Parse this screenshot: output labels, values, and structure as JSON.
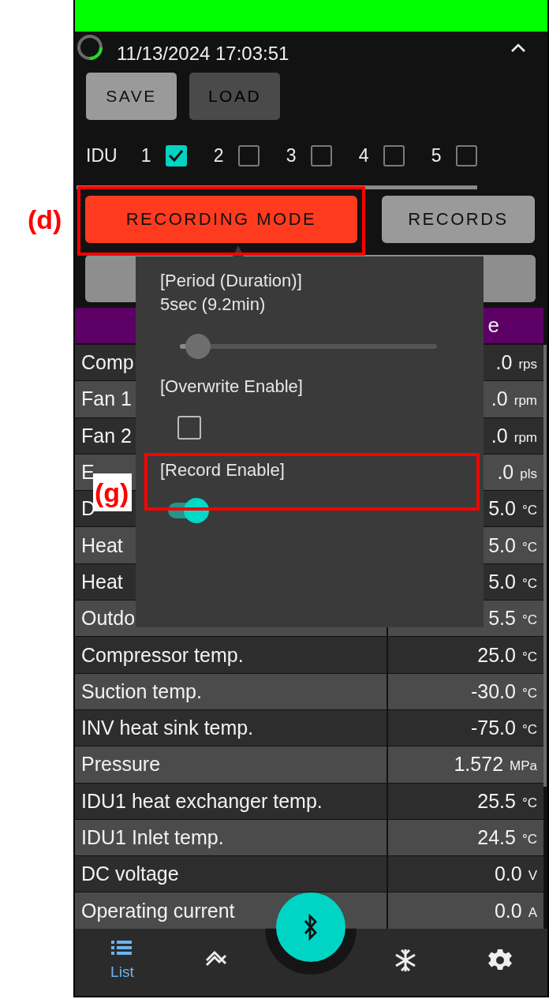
{
  "header": {
    "timestamp": "11/13/2024 17:03:51"
  },
  "file_buttons": [
    {
      "label": "SAVE",
      "disabled": false
    },
    {
      "label": "LOAD",
      "disabled": true
    }
  ],
  "idu": {
    "label": "IDU",
    "units": [
      {
        "number": "1",
        "checked": true
      },
      {
        "number": "2",
        "checked": false
      },
      {
        "number": "3",
        "checked": false
      },
      {
        "number": "4",
        "checked": false
      },
      {
        "number": "5",
        "checked": false
      }
    ]
  },
  "mode_buttons": [
    {
      "label": "RECORDING MODE",
      "selected": true
    },
    {
      "label": "RECORDS",
      "selected": false
    }
  ],
  "table": {
    "header": "e",
    "rows": [
      {
        "label": "Comp",
        "value": ".0",
        "unit": "rps"
      },
      {
        "label": "Fan 1",
        "value": ".0",
        "unit": "rpm"
      },
      {
        "label": "Fan 2",
        "value": ".0",
        "unit": "rpm"
      },
      {
        "label": "E",
        "value": ".0",
        "unit": "pls"
      },
      {
        "label": "D",
        "value": "5.0",
        "unit": "°C"
      },
      {
        "label": "Heat",
        "value": "5.0",
        "unit": "°C"
      },
      {
        "label": "Heat",
        "value": "5.0",
        "unit": "°C"
      },
      {
        "label": "Outdo",
        "value": "5.5",
        "unit": "°C"
      },
      {
        "label": "Compressor temp.",
        "value": "25.0",
        "unit": "°C"
      },
      {
        "label": "Suction temp.",
        "value": "-30.0",
        "unit": "°C"
      },
      {
        "label": "INV heat sink temp.",
        "value": "-75.0",
        "unit": "°C"
      },
      {
        "label": "Pressure",
        "value": "1.572",
        "unit": "MPa"
      },
      {
        "label": "IDU1 heat exchanger temp.",
        "value": "25.5",
        "unit": "°C"
      },
      {
        "label": "IDU1 Inlet temp.",
        "value": "24.5",
        "unit": "°C"
      },
      {
        "label": "DC voltage",
        "value": "0.0",
        "unit": "V"
      },
      {
        "label": "Operating current",
        "value": "0.0",
        "unit": "A"
      }
    ]
  },
  "popover": {
    "items": [
      {
        "kind": "slider",
        "label": "[Period (Duration)]",
        "value": "5sec (9.2min)",
        "level": 0.07
      },
      {
        "kind": "checkbox",
        "label": "[Overwrite Enable]",
        "checked": false
      },
      {
        "kind": "toggle",
        "label": "[Record Enable]",
        "on": true
      }
    ]
  },
  "callouts": [
    {
      "label": "(d)"
    },
    {
      "label": "(g)"
    }
  ],
  "bottom_nav": [
    {
      "kind": "list",
      "label": "List",
      "selected": true
    },
    {
      "kind": "chart",
      "selected": false
    },
    {
      "kind": "bluetooth",
      "selected": false
    },
    {
      "kind": "snowflake",
      "selected": false
    },
    {
      "kind": "settings",
      "selected": false
    }
  ]
}
